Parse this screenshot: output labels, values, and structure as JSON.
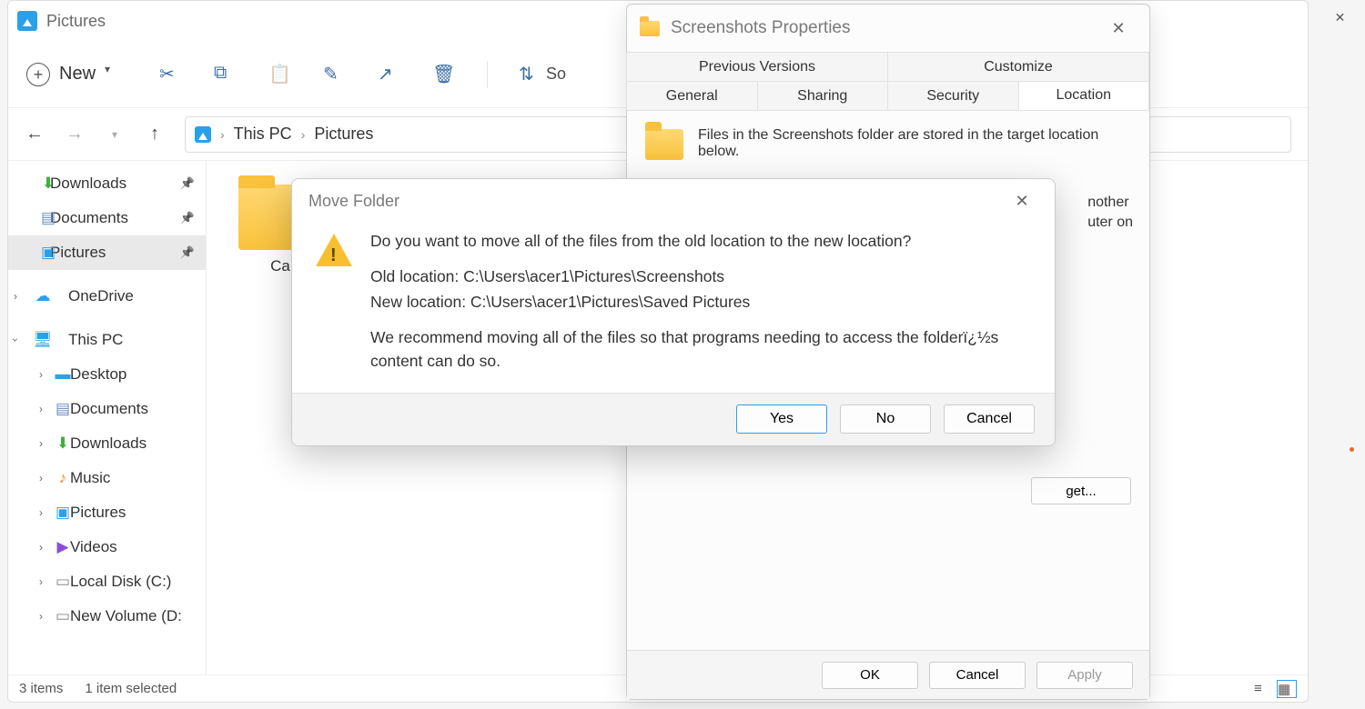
{
  "outer_window": {
    "minimize": "—",
    "maximize": "□",
    "close": "✕"
  },
  "explorer": {
    "title": "Pictures",
    "toolbar": {
      "new_label": "New",
      "sort_label": "So"
    },
    "breadcrumb": {
      "root": "This PC",
      "current": "Pictures"
    },
    "sidebar": {
      "quick": [
        {
          "label": "Downloads"
        },
        {
          "label": "Documents"
        },
        {
          "label": "Pictures"
        }
      ],
      "onedrive": "OneDrive",
      "thispc": {
        "label": "This PC",
        "children": [
          {
            "label": "Desktop"
          },
          {
            "label": "Documents"
          },
          {
            "label": "Downloads"
          },
          {
            "label": "Music"
          },
          {
            "label": "Pictures"
          },
          {
            "label": "Videos"
          },
          {
            "label": "Local Disk (C:)"
          },
          {
            "label": "New Volume (D:"
          }
        ]
      }
    },
    "content": {
      "folder_label": "Ca"
    },
    "status": {
      "items": "3 items",
      "selected": "1 item selected"
    }
  },
  "properties": {
    "title": "Screenshots Properties",
    "tabs_row1": [
      "Previous Versions",
      "Customize"
    ],
    "tabs_row2": [
      "General",
      "Sharing",
      "Security",
      "Location"
    ],
    "active_tab": "Location",
    "desc": "Files in the Screenshots folder are stored in the target location below.",
    "partial_right": [
      "nother",
      "uter on"
    ],
    "find_target": "get...",
    "footer": {
      "ok": "OK",
      "cancel": "Cancel",
      "apply": "Apply"
    }
  },
  "dialog": {
    "title": "Move Folder",
    "question": "Do you want to move all of the files from the old location to the new location?",
    "old_location": "Old location: C:\\Users\\acer1\\Pictures\\Screenshots",
    "new_location": "New location: C:\\Users\\acer1\\Pictures\\Saved Pictures",
    "recommend": "We recommend moving all of the files so that programs needing to access the folderï¿½s content can do so.",
    "buttons": {
      "yes": "Yes",
      "no": "No",
      "cancel": "Cancel"
    }
  }
}
